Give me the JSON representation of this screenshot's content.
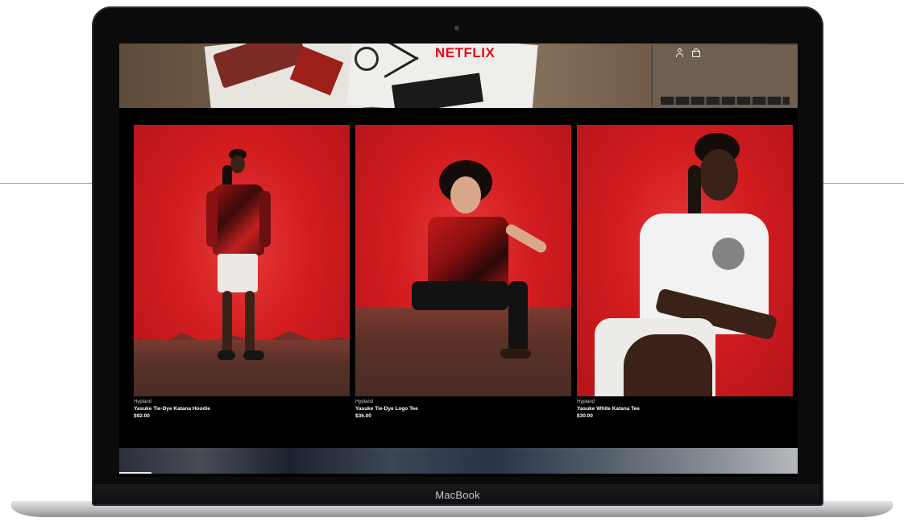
{
  "device": {
    "label": "MacBook"
  },
  "store": {
    "brand": "NETFLIX",
    "header_icons": [
      {
        "name": "account-icon"
      },
      {
        "name": "cart-icon"
      }
    ]
  },
  "products": [
    {
      "vendor": "Hypland",
      "name": "Yasuke Tie-Dye Katana Hoodie",
      "price": "$92.00"
    },
    {
      "vendor": "Hypland",
      "name": "Yasuke Tie-Dye Logo Tee",
      "price": "$36.00"
    },
    {
      "vendor": "Hypland",
      "name": "Yasuke White Katana Tee",
      "price": "$30.00"
    }
  ],
  "colors": {
    "brand_red": "#e50914",
    "photo_red": "#d31d20",
    "page_bg": "#000000"
  }
}
